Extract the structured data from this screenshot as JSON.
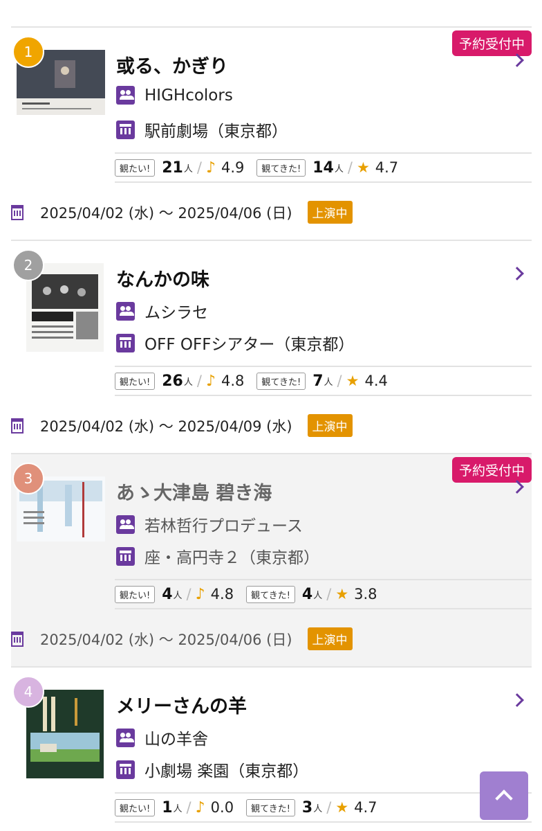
{
  "items": [
    {
      "rank": "1",
      "rank_color": "#f0a500",
      "booking": "予約受付中",
      "title": "或る、かぎり",
      "company": "HIGHcolors",
      "venue": "駅前劇場（東京都）",
      "want_label": "観たい!",
      "want_count": "21",
      "want_unit": "人",
      "want_score": "4.9",
      "seen_label": "観てきた!",
      "seen_count": "14",
      "seen_unit": "人",
      "seen_score": "4.7",
      "date": "2025/04/02 (水) 〜 2025/04/06 (日)",
      "status": "上演中"
    },
    {
      "rank": "2",
      "rank_color": "#a0a0a0",
      "booking": "",
      "title": "なんかの味",
      "company": "ムシラセ",
      "venue": "OFF OFFシアター（東京都）",
      "want_label": "観たい!",
      "want_count": "26",
      "want_unit": "人",
      "want_score": "4.8",
      "seen_label": "観てきた!",
      "seen_count": "7",
      "seen_unit": "人",
      "seen_score": "4.4",
      "date": "2025/04/02 (水) 〜 2025/04/09 (水)",
      "status": "上演中"
    },
    {
      "rank": "3",
      "rank_color": "#e0907a",
      "booking": "予約受付中",
      "title": "あゝ大津島 碧き海",
      "company": "若林哲行プロデュース",
      "venue": "座・高円寺２（東京都）",
      "want_label": "観たい!",
      "want_count": "4",
      "want_unit": "人",
      "want_score": "4.8",
      "seen_label": "観てきた!",
      "seen_count": "4",
      "seen_unit": "人",
      "seen_score": "3.8",
      "date": "2025/04/02 (水) 〜 2025/04/06 (日)",
      "status": "上演中"
    },
    {
      "rank": "4",
      "rank_color": "#d8b4e0",
      "booking": "",
      "title": "メリーさんの羊",
      "company": "山の羊舎",
      "venue": "小劇場 楽園（東京都）",
      "want_label": "観たい!",
      "want_count": "1",
      "want_unit": "人",
      "want_score": "0.0",
      "seen_label": "観てきた!",
      "seen_count": "3",
      "seen_unit": "人",
      "seen_score": "4.7",
      "date": "",
      "status": ""
    }
  ],
  "icons": {
    "note": "♪",
    "star": "★",
    "slash": "/",
    "people": "people-icon",
    "theater": "theater-icon",
    "calendar": "calendar-icon",
    "chevron": "chevron-right-icon"
  },
  "colors": {
    "accent": "#6a3a9e",
    "booking": "#d81a6a",
    "status": "#e39300",
    "back_top": "#a07fd0"
  }
}
